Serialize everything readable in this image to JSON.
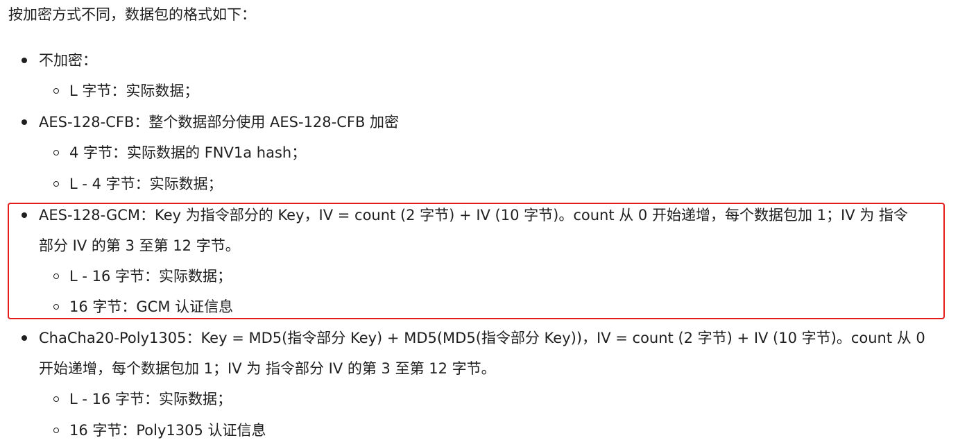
{
  "intro": "按加密方式不同，数据包的格式如下：",
  "items": [
    {
      "label": "不加密：",
      "sub": [
        "L 字节：实际数据；"
      ]
    },
    {
      "label": "AES-128-CFB：整个数据部分使用 AES-128-CFB 加密",
      "sub": [
        "4 字节：实际数据的 FNV1a hash；",
        "L - 4 字节：实际数据；"
      ]
    },
    {
      "label_line1": "AES-128-GCM：Key 为指令部分的 Key，IV = count (2 字节) + IV (10 字节)。count 从 0 开始递增，每个数据包加 1；IV 为 指令",
      "label_line2": "部分 IV 的第 3 至第 12 字节。",
      "sub": [
        "L - 16 字节：实际数据；",
        "16 字节：GCM 认证信息"
      ]
    },
    {
      "label_line1": "ChaCha20-Poly1305：Key = MD5(指令部分 Key) + MD5(MD5(指令部分 Key))，IV = count (2 字节) + IV (10 字节)。count 从 0",
      "label_line2": "开始递增，每个数据包加 1；IV 为 指令部分 IV 的第 3 至第 12 字节。",
      "sub": [
        "L - 16 字节：实际数据；",
        "16 字节：Poly1305 认证信息"
      ]
    }
  ],
  "colors": {
    "text": "#1f1f1f",
    "highlight_border": "#e81b1b",
    "background": "#ffffff"
  }
}
